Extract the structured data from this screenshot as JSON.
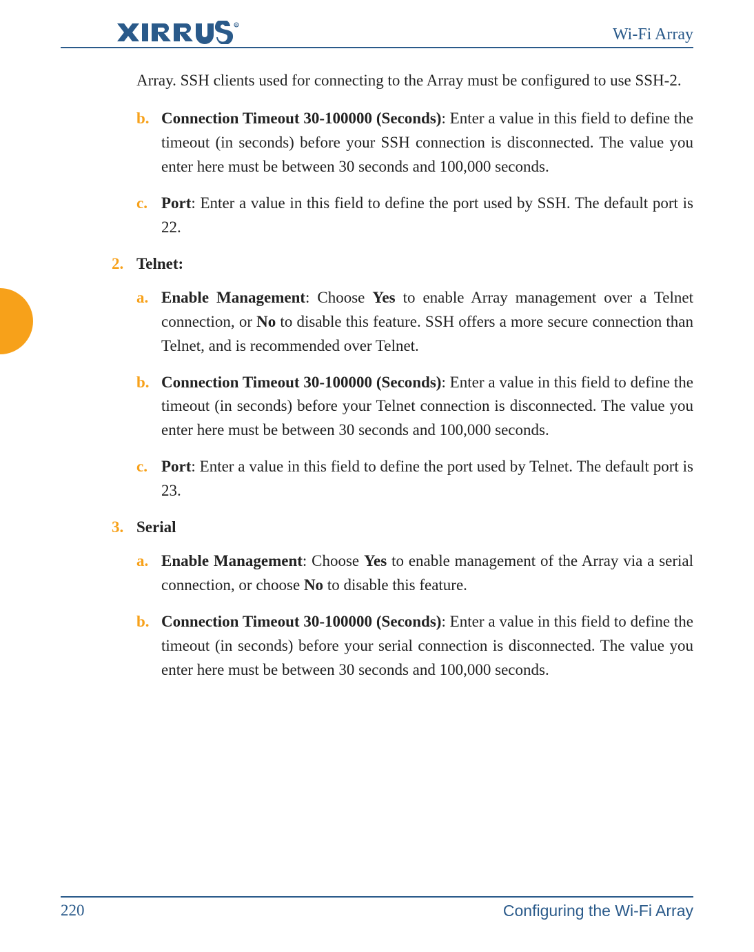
{
  "header": {
    "logo_text": "XIRRUS",
    "title": "Wi-Fi Array"
  },
  "side_tab_color": "#f7a11a",
  "content": {
    "intro_continuation": "Array. SSH clients used for connecting to the Array must be configured to use SSH-2.",
    "section1": {
      "b_marker": "b.",
      "b_term": "Connection Timeout 30-100000 (Seconds)",
      "b_text": ": Enter a value in this field to define the timeout (in seconds) before your SSH connection is disconnected. The value you enter here must be between 30 seconds and 100,000 seconds.",
      "c_marker": "c.",
      "c_term": "Port",
      "c_text": ": Enter a value in this field to define the port used by SSH. The default port is 22."
    },
    "section2": {
      "num_marker": "2.",
      "heading": "Telnet:",
      "a_marker": "a.",
      "a_term": "Enable Management",
      "a_text_1": ": Choose ",
      "a_yes": "Yes",
      "a_text_2": " to enable Array management over a Telnet connection, or ",
      "a_no": "No",
      "a_text_3": " to disable this feature. SSH offers a more secure connection than Telnet, and is recommended over Telnet.",
      "b_marker": "b.",
      "b_term": "Connection Timeout 30-100000 (Seconds)",
      "b_text": ": Enter a value in this field to define the timeout (in seconds) before your Telnet connection is disconnected. The value you enter here must be between 30 seconds and 100,000 seconds.",
      "c_marker": "c.",
      "c_term": "Port",
      "c_text": ": Enter a value in this field to define the port used by Telnet. The default port is 23."
    },
    "section3": {
      "num_marker": "3.",
      "heading": "Serial",
      "a_marker": "a.",
      "a_term": "Enable Management",
      "a_text_1": ": Choose ",
      "a_yes": "Yes",
      "a_text_2": " to enable management of the Array via a serial connection, or choose ",
      "a_no": "No",
      "a_text_3": " to disable this feature.",
      "b_marker": "b.",
      "b_term": "Connection Timeout 30-100000 (Seconds)",
      "b_text": ": Enter a value in this field to define the timeout (in seconds) before your serial connection is disconnected. The value you enter here must be between 30 seconds and 100,000 seconds."
    }
  },
  "footer": {
    "page_number": "220",
    "section_title": "Configuring the Wi-Fi Array"
  }
}
